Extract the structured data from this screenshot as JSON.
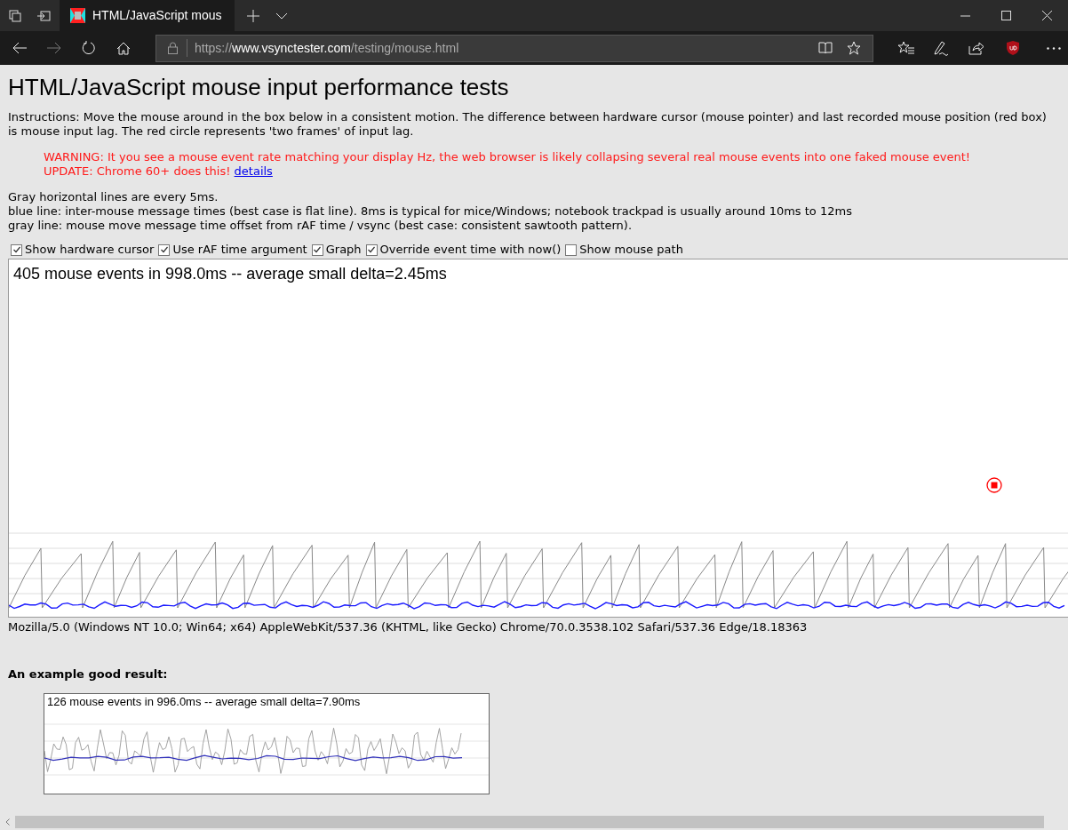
{
  "browser": {
    "tabs": [
      {
        "title": "HTML/JavaScript mous",
        "selected": true
      }
    ],
    "address": {
      "scheme": "https://",
      "host": "www.vsynctester.com",
      "path": "/testing/mouse.html"
    }
  },
  "page": {
    "title": "HTML/JavaScript mouse input performance tests",
    "instructions": "Instructions: Move the mouse around in the box below in a consistent motion. The difference between hardware cursor (mouse pointer) and last recorded mouse position (red box) is mouse input lag. The red circle represents 'two frames' of input lag.",
    "warning": "WARNING: It you see a mouse event rate matching your display Hz, the web browser is likely collapsing several real mouse events into one faked mouse event!",
    "update": "UPDATE: Chrome 60+ does this!",
    "update_link": "details",
    "notes": [
      "Gray horizontal lines are every 5ms.",
      "blue line: inter-mouse message times (best case is flat line). 8ms is typical for mice/Windows; notebook trackpad is usually around 10ms to 12ms",
      "gray line: mouse move message time offset from rAF time / vsync (best case: consistent sawtooth pattern)."
    ],
    "options": [
      {
        "label": "Show hardware cursor",
        "checked": true
      },
      {
        "label": "Use rAF time argument",
        "checked": true
      },
      {
        "label": "Graph",
        "checked": true
      },
      {
        "label": "Override event time with now()",
        "checked": true
      },
      {
        "label": "Show mouse path",
        "checked": false
      }
    ],
    "graph": {
      "summary": "405 mouse events in 998.0ms -- average small delta=2.45ms"
    },
    "user_agent": "Mozilla/5.0 (Windows NT 10.0; Win64; x64) AppleWebKit/537.36 (KHTML, like Gecko) Chrome/70.0.3538.102 Safari/537.36 Edge/18.18363",
    "example": {
      "heading": "An example good result:",
      "summary": "126 mouse events in 996.0ms -- average small delta=7.90ms"
    }
  }
}
